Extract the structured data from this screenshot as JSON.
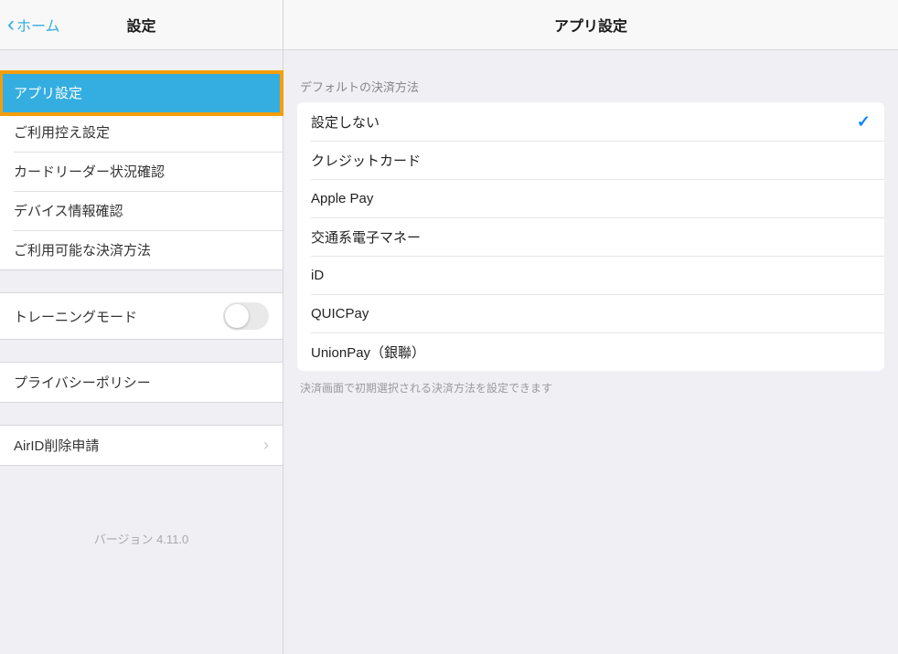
{
  "sidebar": {
    "back_label": "ホーム",
    "title": "設定",
    "version": "バージョン 4.11.0",
    "groups": [
      {
        "highlighted": true,
        "items": [
          {
            "label": "アプリ設定",
            "selected": true
          },
          {
            "label": "ご利用控え設定"
          },
          {
            "label": "カードリーダー状況確認"
          },
          {
            "label": "デバイス情報確認"
          },
          {
            "label": "ご利用可能な決済方法"
          }
        ]
      },
      {
        "items": [
          {
            "label": "トレーニングモード",
            "toggle": true,
            "toggle_on": false
          }
        ]
      },
      {
        "items": [
          {
            "label": "プライバシーポリシー"
          }
        ]
      },
      {
        "items": [
          {
            "label": "AirID削除申請",
            "chevron": true
          }
        ]
      }
    ]
  },
  "detail": {
    "title": "アプリ設定",
    "section_header": "デフォルトの決済方法",
    "section_footer": "決済画面で初期選択される決済方法を設定できます",
    "options": [
      {
        "label": "設定しない",
        "checked": true
      },
      {
        "label": "クレジットカード"
      },
      {
        "label": "Apple Pay"
      },
      {
        "label": "交通系電子マネー"
      },
      {
        "label": "iD"
      },
      {
        "label": "QUICPay"
      },
      {
        "label": "UnionPay（銀聯）"
      }
    ]
  }
}
